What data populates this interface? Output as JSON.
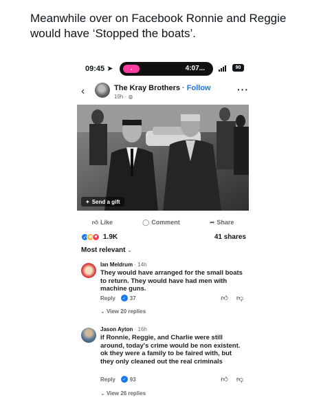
{
  "tweet": {
    "text": "Meanwhile over on Facebook Ronnie and Reggie would have ‘Stopped the boats’."
  },
  "status_bar": {
    "time": "09:45",
    "island_time": "4:07...",
    "battery": "90"
  },
  "post": {
    "page_name": "The Kray Brothers",
    "follow_label": "Follow",
    "meta": "19h · ",
    "gift_label": "Send a gift",
    "actions": {
      "like": "Like",
      "comment": "Comment",
      "share": "Share"
    },
    "reactions_count": "1.9K",
    "shares": "41 shares",
    "sort_label": "Most relevant"
  },
  "comments": [
    {
      "name": "Ian Meldrum",
      "time": "14h",
      "text": "They would have arranged for the small boats to return. They would have had men with machine guns.",
      "reply_label": "Reply",
      "likes": "37",
      "replies": "View 20 replies"
    },
    {
      "name": "Jason Ayton",
      "time": "16h",
      "text": "if Ronnie, Reggie, and Charlie were still around, today's crime would be non existent. ok they were a family to be faired with, but they only cleaned out the real criminals",
      "reply_label": "Reply",
      "likes": "93",
      "replies": "View 26 replies"
    }
  ]
}
